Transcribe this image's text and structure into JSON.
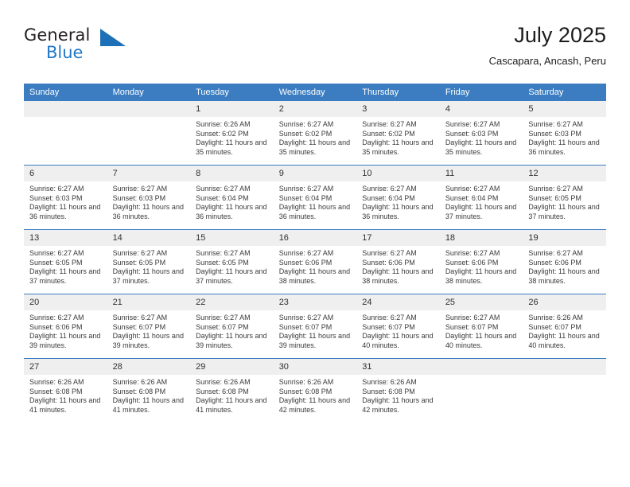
{
  "brand": {
    "name_part1": "General",
    "name_part2": "Blue",
    "logo_icon": "triangle-logo-icon",
    "accent_color": "#2277c8"
  },
  "header": {
    "title": "July 2025",
    "subtitle": "Cascapara, Ancash, Peru"
  },
  "colors": {
    "header_blue": "#3b7dc0",
    "daynum_band": "#efefef",
    "text": "#3a3a3a"
  },
  "weekdays": [
    "Sunday",
    "Monday",
    "Tuesday",
    "Wednesday",
    "Thursday",
    "Friday",
    "Saturday"
  ],
  "weeks": [
    [
      {
        "day": "",
        "empty": true
      },
      {
        "day": "",
        "empty": true
      },
      {
        "day": "1",
        "sunrise": "Sunrise: 6:26 AM",
        "sunset": "Sunset: 6:02 PM",
        "daylight": "Daylight: 11 hours and 35 minutes."
      },
      {
        "day": "2",
        "sunrise": "Sunrise: 6:27 AM",
        "sunset": "Sunset: 6:02 PM",
        "daylight": "Daylight: 11 hours and 35 minutes."
      },
      {
        "day": "3",
        "sunrise": "Sunrise: 6:27 AM",
        "sunset": "Sunset: 6:02 PM",
        "daylight": "Daylight: 11 hours and 35 minutes."
      },
      {
        "day": "4",
        "sunrise": "Sunrise: 6:27 AM",
        "sunset": "Sunset: 6:03 PM",
        "daylight": "Daylight: 11 hours and 35 minutes."
      },
      {
        "day": "5",
        "sunrise": "Sunrise: 6:27 AM",
        "sunset": "Sunset: 6:03 PM",
        "daylight": "Daylight: 11 hours and 36 minutes."
      }
    ],
    [
      {
        "day": "6",
        "sunrise": "Sunrise: 6:27 AM",
        "sunset": "Sunset: 6:03 PM",
        "daylight": "Daylight: 11 hours and 36 minutes."
      },
      {
        "day": "7",
        "sunrise": "Sunrise: 6:27 AM",
        "sunset": "Sunset: 6:03 PM",
        "daylight": "Daylight: 11 hours and 36 minutes."
      },
      {
        "day": "8",
        "sunrise": "Sunrise: 6:27 AM",
        "sunset": "Sunset: 6:04 PM",
        "daylight": "Daylight: 11 hours and 36 minutes."
      },
      {
        "day": "9",
        "sunrise": "Sunrise: 6:27 AM",
        "sunset": "Sunset: 6:04 PM",
        "daylight": "Daylight: 11 hours and 36 minutes."
      },
      {
        "day": "10",
        "sunrise": "Sunrise: 6:27 AM",
        "sunset": "Sunset: 6:04 PM",
        "daylight": "Daylight: 11 hours and 36 minutes."
      },
      {
        "day": "11",
        "sunrise": "Sunrise: 6:27 AM",
        "sunset": "Sunset: 6:04 PM",
        "daylight": "Daylight: 11 hours and 37 minutes."
      },
      {
        "day": "12",
        "sunrise": "Sunrise: 6:27 AM",
        "sunset": "Sunset: 6:05 PM",
        "daylight": "Daylight: 11 hours and 37 minutes."
      }
    ],
    [
      {
        "day": "13",
        "sunrise": "Sunrise: 6:27 AM",
        "sunset": "Sunset: 6:05 PM",
        "daylight": "Daylight: 11 hours and 37 minutes."
      },
      {
        "day": "14",
        "sunrise": "Sunrise: 6:27 AM",
        "sunset": "Sunset: 6:05 PM",
        "daylight": "Daylight: 11 hours and 37 minutes."
      },
      {
        "day": "15",
        "sunrise": "Sunrise: 6:27 AM",
        "sunset": "Sunset: 6:05 PM",
        "daylight": "Daylight: 11 hours and 37 minutes."
      },
      {
        "day": "16",
        "sunrise": "Sunrise: 6:27 AM",
        "sunset": "Sunset: 6:06 PM",
        "daylight": "Daylight: 11 hours and 38 minutes."
      },
      {
        "day": "17",
        "sunrise": "Sunrise: 6:27 AM",
        "sunset": "Sunset: 6:06 PM",
        "daylight": "Daylight: 11 hours and 38 minutes."
      },
      {
        "day": "18",
        "sunrise": "Sunrise: 6:27 AM",
        "sunset": "Sunset: 6:06 PM",
        "daylight": "Daylight: 11 hours and 38 minutes."
      },
      {
        "day": "19",
        "sunrise": "Sunrise: 6:27 AM",
        "sunset": "Sunset: 6:06 PM",
        "daylight": "Daylight: 11 hours and 38 minutes."
      }
    ],
    [
      {
        "day": "20",
        "sunrise": "Sunrise: 6:27 AM",
        "sunset": "Sunset: 6:06 PM",
        "daylight": "Daylight: 11 hours and 39 minutes."
      },
      {
        "day": "21",
        "sunrise": "Sunrise: 6:27 AM",
        "sunset": "Sunset: 6:07 PM",
        "daylight": "Daylight: 11 hours and 39 minutes."
      },
      {
        "day": "22",
        "sunrise": "Sunrise: 6:27 AM",
        "sunset": "Sunset: 6:07 PM",
        "daylight": "Daylight: 11 hours and 39 minutes."
      },
      {
        "day": "23",
        "sunrise": "Sunrise: 6:27 AM",
        "sunset": "Sunset: 6:07 PM",
        "daylight": "Daylight: 11 hours and 39 minutes."
      },
      {
        "day": "24",
        "sunrise": "Sunrise: 6:27 AM",
        "sunset": "Sunset: 6:07 PM",
        "daylight": "Daylight: 11 hours and 40 minutes."
      },
      {
        "day": "25",
        "sunrise": "Sunrise: 6:27 AM",
        "sunset": "Sunset: 6:07 PM",
        "daylight": "Daylight: 11 hours and 40 minutes."
      },
      {
        "day": "26",
        "sunrise": "Sunrise: 6:26 AM",
        "sunset": "Sunset: 6:07 PM",
        "daylight": "Daylight: 11 hours and 40 minutes."
      }
    ],
    [
      {
        "day": "27",
        "sunrise": "Sunrise: 6:26 AM",
        "sunset": "Sunset: 6:08 PM",
        "daylight": "Daylight: 11 hours and 41 minutes."
      },
      {
        "day": "28",
        "sunrise": "Sunrise: 6:26 AM",
        "sunset": "Sunset: 6:08 PM",
        "daylight": "Daylight: 11 hours and 41 minutes."
      },
      {
        "day": "29",
        "sunrise": "Sunrise: 6:26 AM",
        "sunset": "Sunset: 6:08 PM",
        "daylight": "Daylight: 11 hours and 41 minutes."
      },
      {
        "day": "30",
        "sunrise": "Sunrise: 6:26 AM",
        "sunset": "Sunset: 6:08 PM",
        "daylight": "Daylight: 11 hours and 42 minutes."
      },
      {
        "day": "31",
        "sunrise": "Sunrise: 6:26 AM",
        "sunset": "Sunset: 6:08 PM",
        "daylight": "Daylight: 11 hours and 42 minutes."
      },
      {
        "day": "",
        "empty": true
      },
      {
        "day": "",
        "empty": true
      }
    ]
  ]
}
